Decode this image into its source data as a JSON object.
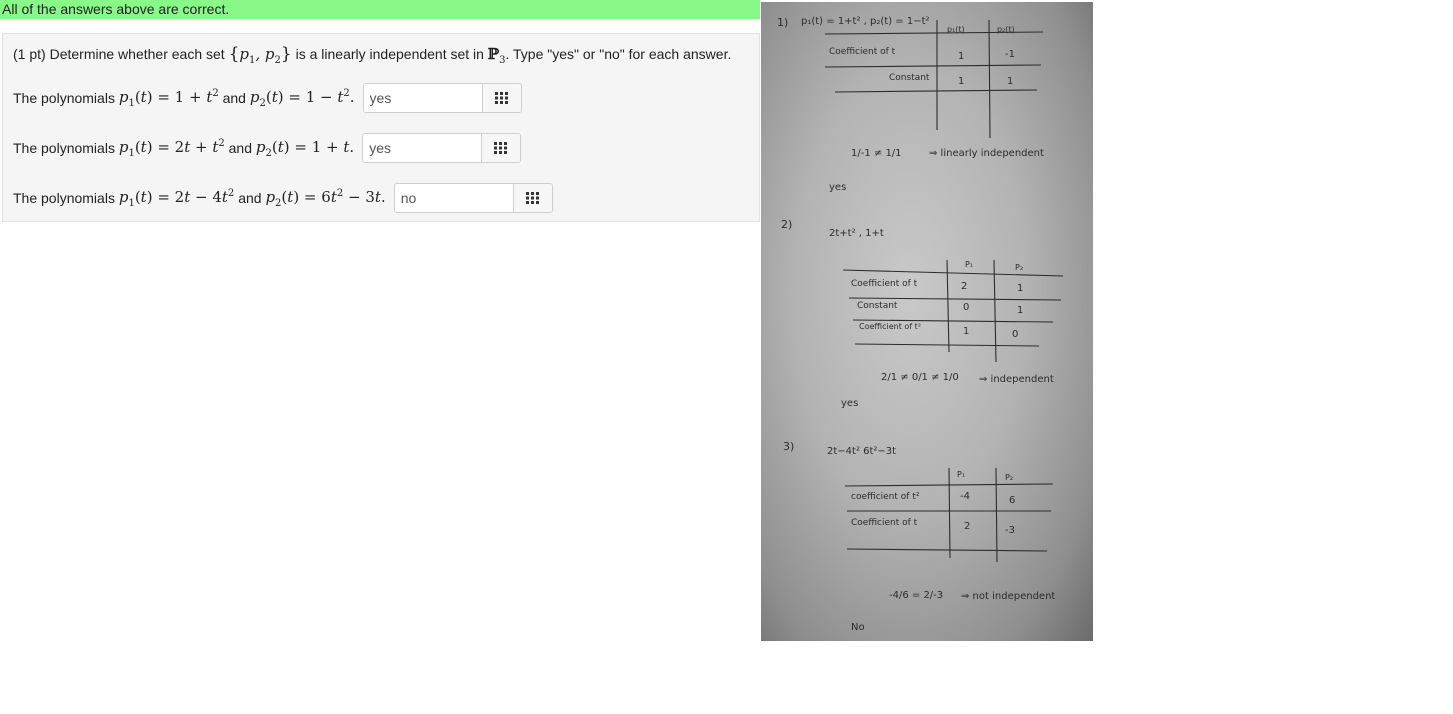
{
  "banner": {
    "text": "All of the answers above are correct."
  },
  "problem": {
    "points": "(1 pt)",
    "intro": "Determine whether each set",
    "mid": "is a linearly independent set in",
    "tail": ". Type \"yes\" or \"no\" for each answer.",
    "lead": "The polynomials",
    "conj": "and",
    "answers": [
      "yes",
      "yes",
      "no"
    ]
  },
  "scan": {
    "s1_header": "p₁(t) = 1+t² ,  p₂(t) = 1−t²",
    "s1_col1": "p₁(t)",
    "s1_col2": "p₂(t)",
    "s1_row1_label": "Coefficient of t",
    "s1_row1_v1": "1",
    "s1_row1_v2": "-1",
    "s1_row2_label": "Constant",
    "s1_row2_v1": "1",
    "s1_row2_v2": "1",
    "s1_ratio": "1/-1  ≠  1/1",
    "s1_conclusion": "⇒  linearly independent",
    "s1_answer": "yes",
    "s2_label": "2)",
    "s2_header": "2t+t² ,  1+t",
    "s2_col1": "P₁",
    "s2_col2": "P₂",
    "s2_row1_label": "Coefficient of t",
    "s2_row1_v1": "2",
    "s2_row1_v2": "1",
    "s2_row2_label": "Constant",
    "s2_row2_v1": "0",
    "s2_row2_v2": "1",
    "s2_row3_label": "Coefficient of t²",
    "s2_row3_v1": "1",
    "s2_row3_v2": "0",
    "s2_ratio": "2/1 ≠ 0/1 ≠ 1/0",
    "s2_conclusion": "⇒  independent",
    "s2_answer": "yes",
    "s3_label": "3)",
    "s3_header": "2t−4t²     6t²−3t",
    "s3_col1": "P₁",
    "s3_col2": "P₂",
    "s3_row1_label": "coefficient of t²",
    "s3_row1_v1": "-4",
    "s3_row1_v2": "6",
    "s3_row2_label": "Coefficient of t",
    "s3_row2_v1": "2",
    "s3_row2_v2": "-3",
    "s3_ratio": "-4/6 = 2/-3",
    "s3_conclusion": "⇒ not independent",
    "s3_answer": "No"
  }
}
